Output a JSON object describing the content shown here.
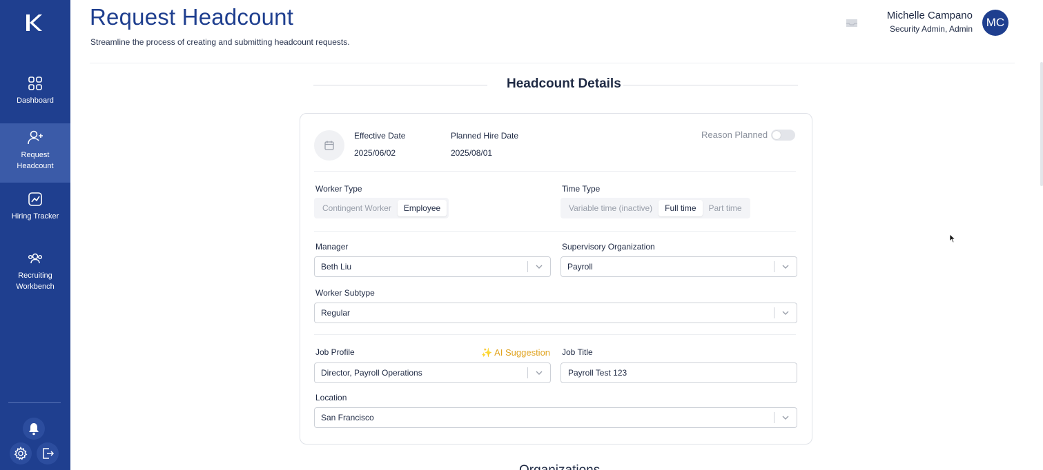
{
  "sidebar": {
    "logo_letter": "K",
    "items": [
      {
        "label": "Dashboard",
        "icon": "grid-icon",
        "active": false
      },
      {
        "label": "Request Headcount",
        "icon": "user-plus-icon",
        "active": true
      },
      {
        "label": "Hiring Tracker",
        "icon": "chart-tracker-icon",
        "active": false
      },
      {
        "label": "Recruiting Workbench",
        "icon": "people-icon",
        "active": false
      }
    ],
    "bottom_icons": [
      "bell-icon",
      "gear-icon",
      "logout-icon"
    ]
  },
  "header": {
    "title": "Request Headcount",
    "subtitle": "Streamline the process of creating and submitting headcount requests.",
    "user_name": "Michelle Campano",
    "user_role": "Security Admin, Admin",
    "avatar_initials": "MC"
  },
  "section": {
    "title": "Headcount Details",
    "next_title": "Organizations"
  },
  "form": {
    "effective_date_label": "Effective Date",
    "effective_date_value": "2025/06/02",
    "planned_hire_date_label": "Planned Hire Date",
    "planned_hire_date_value": "2025/08/01",
    "reason_planned_label": "Reason Planned",
    "reason_planned_on": false,
    "worker_type_label": "Worker Type",
    "worker_type_options": [
      "Contingent Worker",
      "Employee"
    ],
    "worker_type_selected": "Employee",
    "time_type_label": "Time Type",
    "time_type_options": [
      "Variable time (inactive)",
      "Full time",
      "Part time"
    ],
    "time_type_selected": "Full time",
    "manager_label": "Manager",
    "manager_value": "Beth Liu",
    "supervisory_org_label": "Supervisory Organization",
    "supervisory_org_value": "Payroll",
    "worker_subtype_label": "Worker Subtype",
    "worker_subtype_value": "Regular",
    "job_profile_label": "Job Profile",
    "ai_suggestion_label": "✨ AI Suggestion",
    "job_profile_value": "Director, Payroll Operations",
    "job_title_label": "Job Title",
    "job_title_value": "Payroll Test 123",
    "location_label": "Location",
    "location_value": "San Francisco"
  },
  "colors": {
    "sidebar_bg": "#1f3f8f",
    "sidebar_active": "#3b5ba8",
    "accent": "#1f3f8f",
    "ai_suggestion": "#e0a31f"
  }
}
